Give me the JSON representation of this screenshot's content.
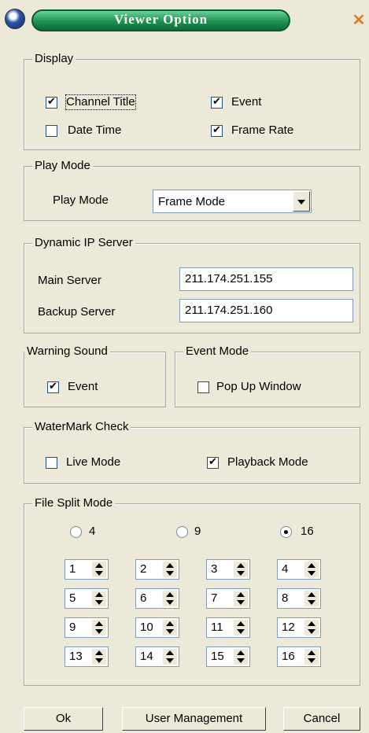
{
  "window": {
    "title": "Viewer Option",
    "close_symbol": "✕"
  },
  "display": {
    "legend": "Display",
    "channel_title": {
      "label": "Channel Title",
      "checked": true
    },
    "event": {
      "label": "Event",
      "checked": true
    },
    "date_time": {
      "label": "Date Time",
      "checked": false
    },
    "frame_rate": {
      "label": "Frame Rate",
      "checked": true
    }
  },
  "play_mode": {
    "legend": "Play Mode",
    "label": "Play Mode",
    "value": "Frame Mode"
  },
  "dynamic_ip": {
    "legend": "Dynamic IP Server",
    "main_label": "Main Server",
    "main_value": "211.174.251.155",
    "backup_label": "Backup Server",
    "backup_value": "211.174.251.160"
  },
  "warning_sound": {
    "legend": "Warning Sound",
    "event_label": "Event",
    "event_checked": true
  },
  "event_mode": {
    "legend": "Event Mode",
    "popup_label": "Pop Up Window",
    "popup_checked": false
  },
  "watermark": {
    "legend": "WaterMark Check",
    "live_label": "Live Mode",
    "live_checked": false,
    "playback_label": "Playback Mode",
    "playback_checked": true
  },
  "file_split": {
    "legend": "File Split Mode",
    "options": [
      "4",
      "9",
      "16"
    ],
    "selected": "16",
    "spinners": [
      "1",
      "2",
      "3",
      "4",
      "5",
      "6",
      "7",
      "8",
      "9",
      "10",
      "11",
      "12",
      "13",
      "14",
      "15",
      "16"
    ]
  },
  "buttons": {
    "ok": "Ok",
    "user_management": "User Management",
    "cancel": "Cancel"
  }
}
